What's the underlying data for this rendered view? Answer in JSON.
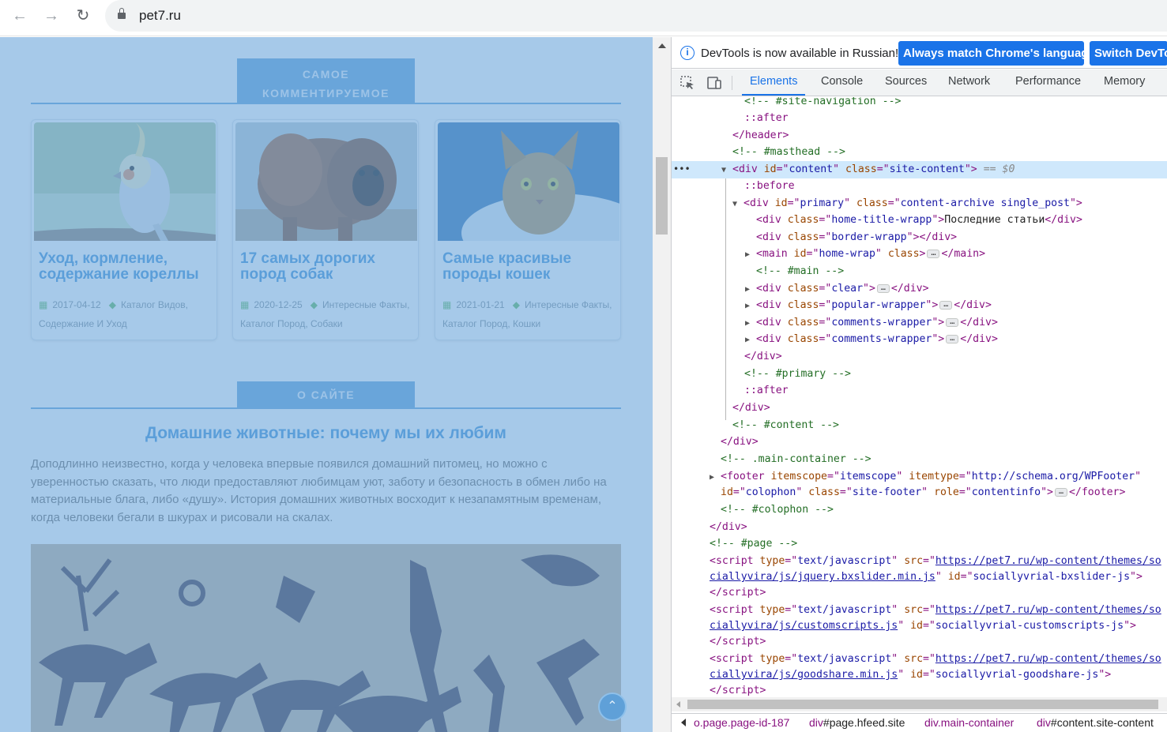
{
  "browser": {
    "url": "pet7.ru"
  },
  "page": {
    "section_commented": "САМОЕ КОММЕНТИРУЕМОЕ",
    "section_about": "О САЙТЕ",
    "cards": [
      {
        "title": "Уход, кормление, содержание кореллы",
        "date": "2017-04-12",
        "tags": "Каталог Видов, Содержание И Уход"
      },
      {
        "title": "17 самых дорогих пород собак",
        "date": "2020-12-25",
        "tags": "Интересные Факты, Каталог Пород, Собаки"
      },
      {
        "title": "Самые красивые породы кошек",
        "date": "2021-01-21",
        "tags": "Интересные Факты, Каталог Пород, Кошки"
      }
    ],
    "about_title": "Домашние животные: почему мы их любим",
    "about_text": "Доподлинно  неизвестно, когда у человека впервые появился домашний питомец, но можно с уверенностью сказать, что люди предоставляют любимцам уют, заботу и безопасность в обмен либо на материальные блага, либо «душу». История домашних животных восходит к незапамятным временам, когда человеки бегали в шкурах и рисовали на скалах."
  },
  "devtools": {
    "info_text": "DevTools is now available in Russian!",
    "btn_match": "Always match Chrome's language",
    "btn_switch": "Switch DevTools to Russian",
    "tabs": [
      "Elements",
      "Console",
      "Sources",
      "Network",
      "Performance",
      "Memory"
    ],
    "active_tab": "Elements",
    "breadcrumbs": [
      {
        "tag": "",
        "rest": "o.page.page-id-187"
      },
      {
        "tag": "div",
        "rest": "#page.hfeed.site"
      },
      {
        "tag": "div",
        "rest": ".main-container"
      },
      {
        "tag": "div",
        "rest": "#content.site-content"
      }
    ]
  },
  "colors": {
    "accent": "#1a73e8",
    "site_blue": "#3a8fd6",
    "overlay": "#6fa8dc",
    "selected_row": "#cfe8fc"
  }
}
